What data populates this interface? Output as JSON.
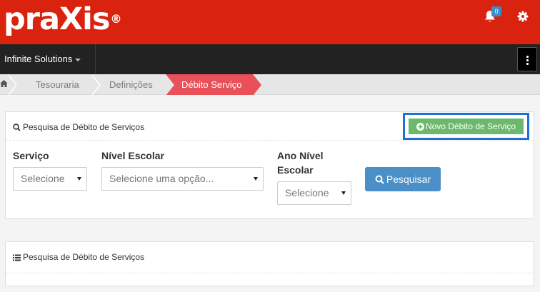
{
  "header": {
    "logo_text": "praXis",
    "logo_mark": "®",
    "notifications_count": "0",
    "icons": [
      "bell-icon",
      "gear-icon"
    ]
  },
  "navbar": {
    "brand": "Infinite Solutions"
  },
  "breadcrumb": {
    "items": [
      "Tesouraria",
      "Definições"
    ],
    "active": "Débito Serviço"
  },
  "search_panel": {
    "title": "Pesquisa de Débito de Serviços",
    "new_button": "Novo Débito de Serviço",
    "fields": {
      "servico": {
        "label": "Serviço",
        "value": "Selecione"
      },
      "nivel_escolar": {
        "label": "Nível Escolar",
        "value": "Selecione uma opção..."
      },
      "ano_nivel_escolar": {
        "label_line1": "Ano Nível",
        "label_line2": "Escolar",
        "value": "Selecione"
      }
    },
    "search_button": "Pesquisar"
  },
  "results_panel": {
    "title": "Pesquisa de Débito de Serviços"
  },
  "colors": {
    "header_red": "#d9230f",
    "navbar_dark": "#222222",
    "active_crumb": "#e9505a",
    "success_green": "#6cb86c",
    "primary_blue": "#4a8fc7",
    "highlight_blue": "#1e6fd6"
  }
}
